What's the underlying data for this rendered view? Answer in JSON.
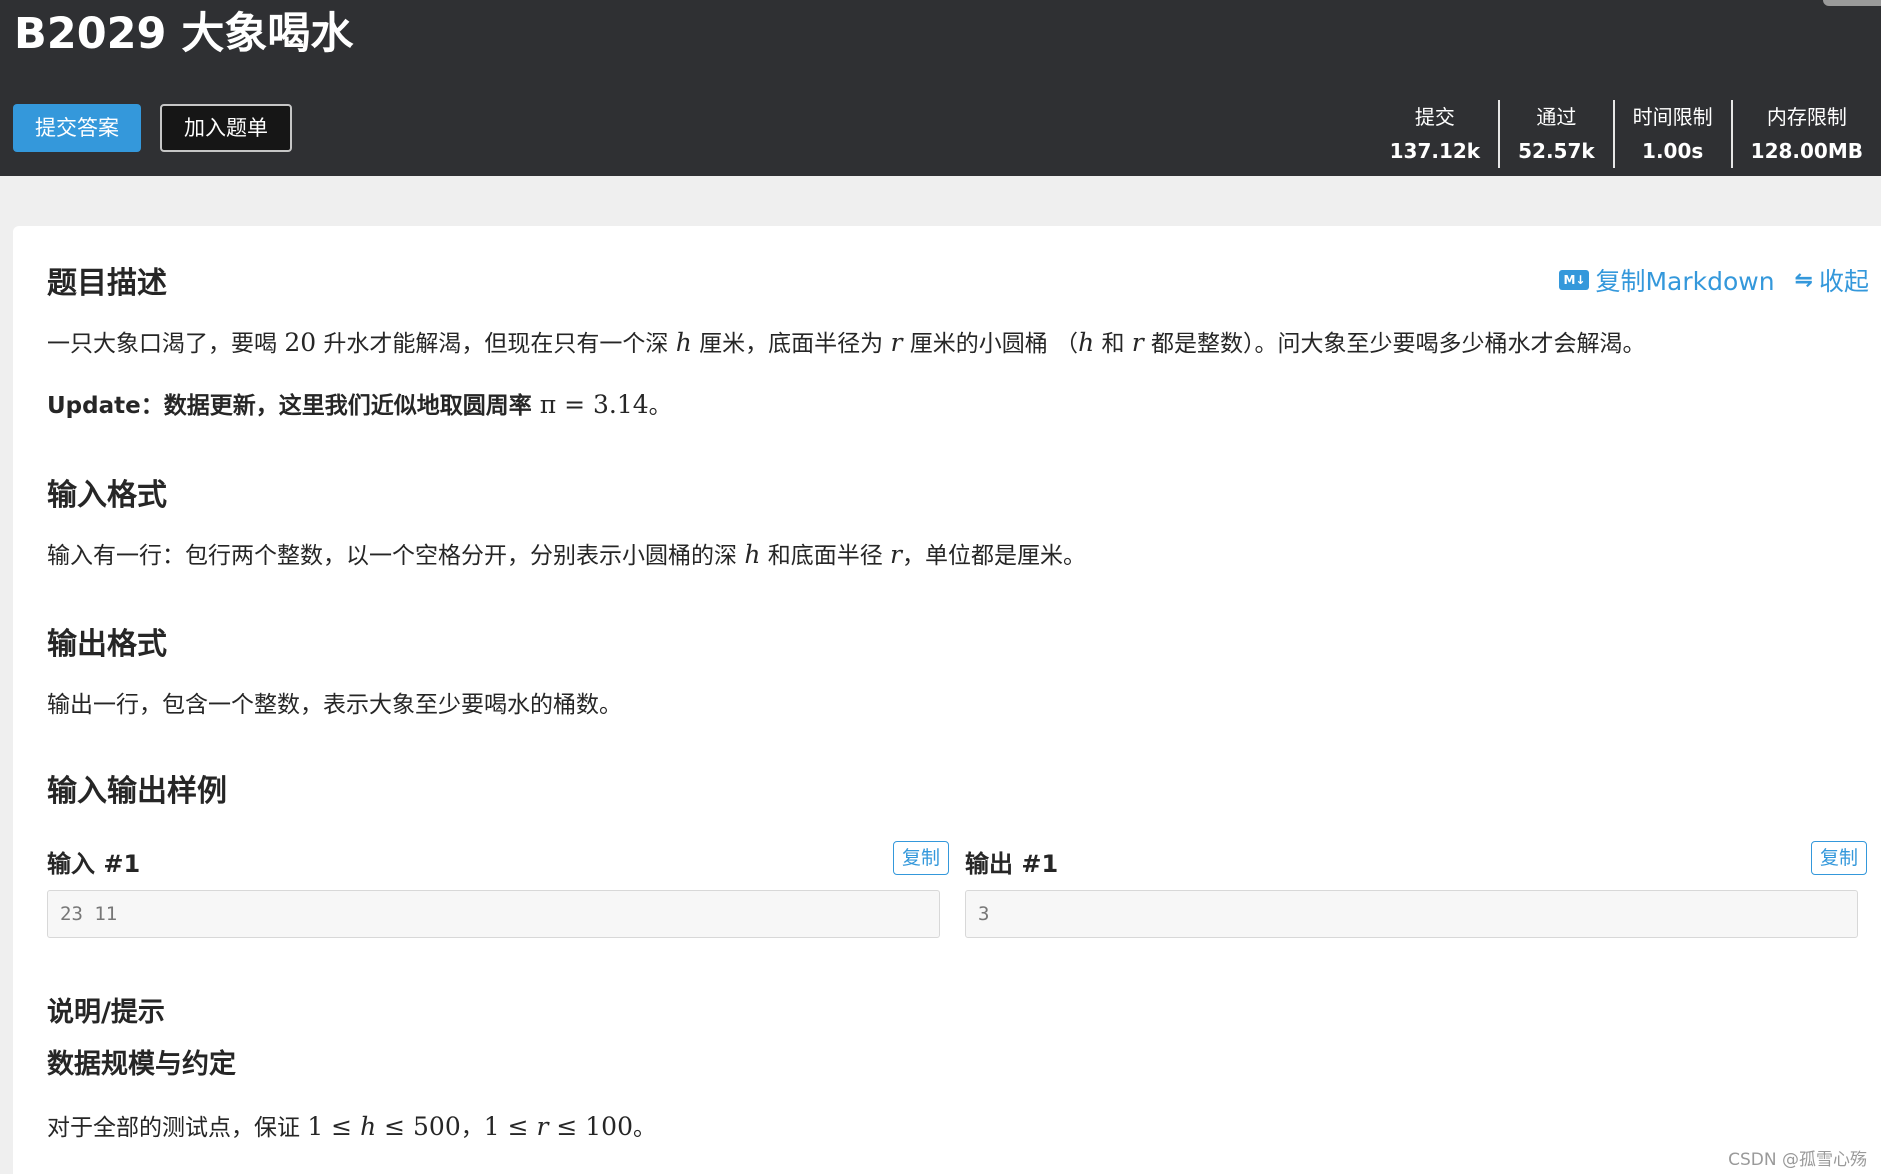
{
  "problem": {
    "title": "B2029 大象喝水"
  },
  "actions": {
    "submit": "提交答案",
    "add_to_list": "加入题单"
  },
  "stats": [
    {
      "label": "提交",
      "value": "137.12k"
    },
    {
      "label": "通过",
      "value": "52.57k"
    },
    {
      "label": "时间限制",
      "value": "1.00s"
    },
    {
      "label": "内存限制",
      "value": "128.00MB"
    }
  ],
  "tools": {
    "md_icon": "M↓",
    "copy_markdown": "复制Markdown",
    "collapse": "收起"
  },
  "description": {
    "heading": "题目描述",
    "line1": [
      "一只大象口渴了，要喝 ",
      "20",
      " 升水才能解渴，但现在只有一个深 ",
      "h",
      " 厘米，底面半径为 ",
      "r",
      " 厘米的小圆桶 （",
      "h",
      " 和 ",
      "r",
      " 都是整数）。问大象至少要喝多少桶水才会解渴。"
    ],
    "update": [
      "Update：数据更新，这里我们近似地取圆周率 ",
      "π = 3.14",
      "。"
    ]
  },
  "input_format": {
    "heading": "输入格式",
    "text": [
      "输入有一行：包行两个整数，以一个空格分开，分别表示小圆桶的深 ",
      "h",
      " 和底面半径 ",
      "r",
      "，单位都是厘米。"
    ]
  },
  "output_format": {
    "heading": "输出格式",
    "text": "输出一行，包含一个整数，表示大象至少要喝水的桶数。"
  },
  "samples": {
    "heading": "输入输出样例",
    "input_label": "输入 #1",
    "output_label": "输出 #1",
    "copy": "复制",
    "input_value": "23 11",
    "output_value": "3"
  },
  "hint": {
    "heading": "说明/提示",
    "subheading": "数据规模与约定",
    "text": [
      "对于全部的测试点，保证 ",
      "1 ≤ ",
      "h",
      " ≤ 500",
      "，",
      "1 ≤ ",
      "r",
      " ≤ 100",
      "。"
    ]
  },
  "watermark": "CSDN @孤雪心殇"
}
